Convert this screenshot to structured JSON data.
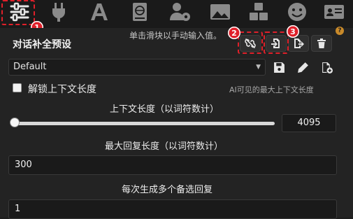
{
  "toolbar_icons": [
    "sliders-icon",
    "plug-icon",
    "font-icon",
    "book-globe-icon",
    "users-gear-icon",
    "image-icon",
    "cubes-icon",
    "smile-icon",
    "id-card-icon"
  ],
  "hint_text": "单击滑块以手动输入值。",
  "preset": {
    "title": "对话补全预设",
    "selected": "Default"
  },
  "badges": [
    "1",
    "2",
    "3"
  ],
  "unlock_context_label": "解锁上下文长度",
  "ai_visible_hint": "AI可见的最大上下文长度",
  "context": {
    "label": "上下文长度（以词符数计）",
    "value": "4095",
    "slider_fraction": 0.0
  },
  "max_response": {
    "label": "最大回复长度（以词符数计）",
    "value": "300"
  },
  "swipes": {
    "label": "每次生成多个备选回复",
    "value": "1"
  },
  "colors": {
    "highlight": "#e0202a",
    "background": "#1f1f1f"
  }
}
